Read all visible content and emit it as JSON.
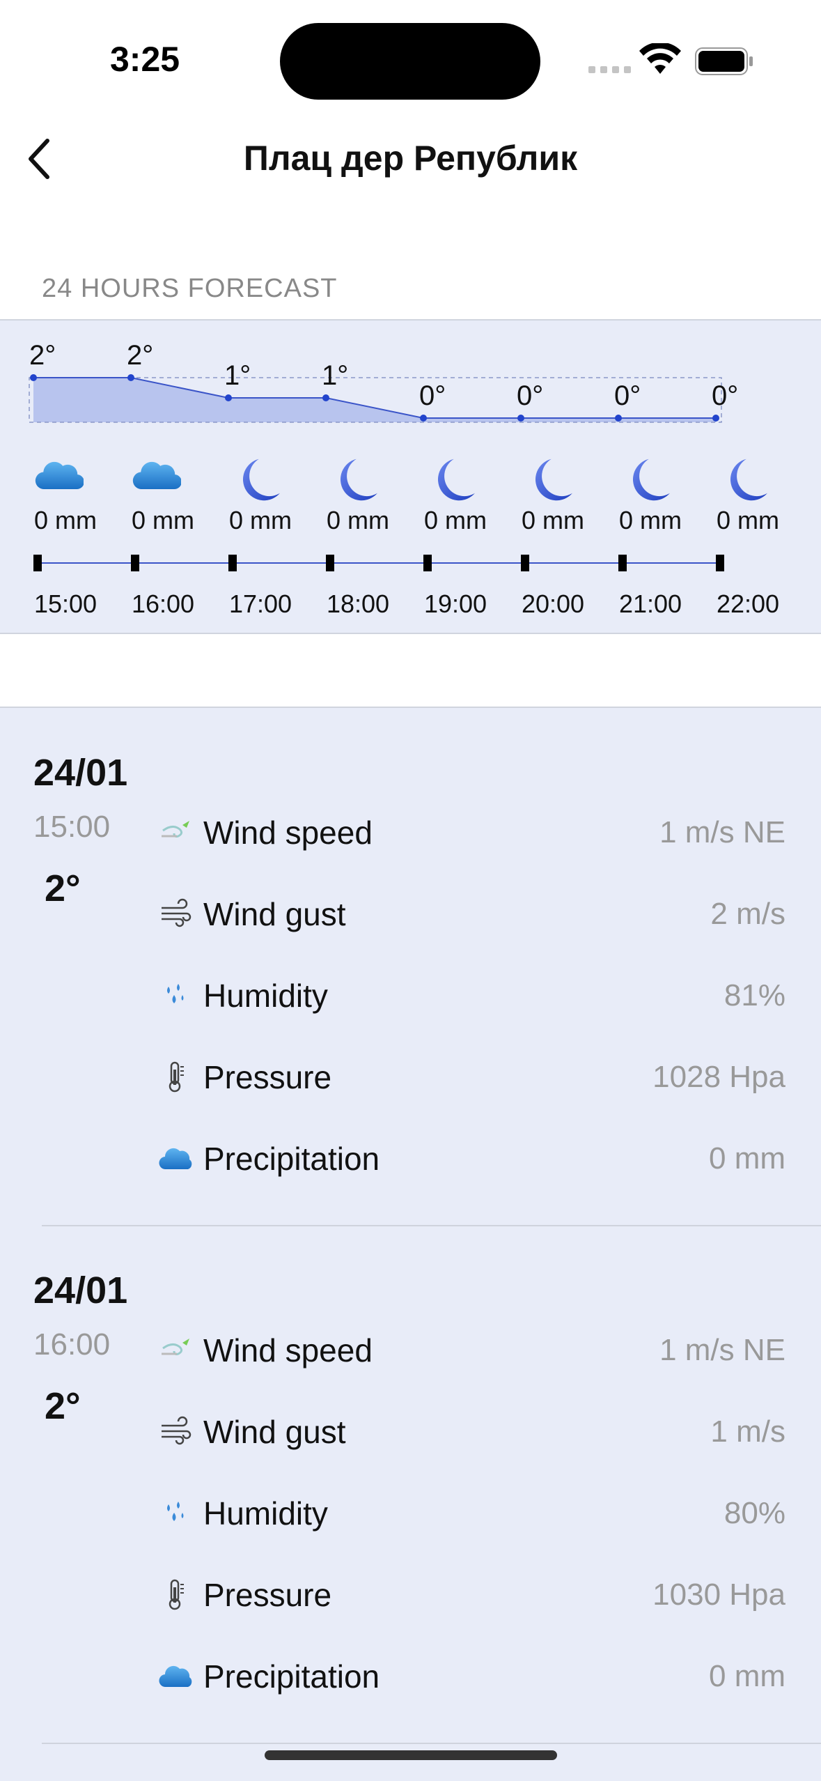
{
  "status": {
    "time": "3:25"
  },
  "nav": {
    "title": "Плац дер Републик",
    "back_icon": "chevron-left-icon"
  },
  "section_label": "24 HOURS FORECAST",
  "forecast": {
    "hours": [
      {
        "time": "15:00",
        "temp": "2°",
        "temp_value": 2,
        "precip": "0 mm",
        "icon": "cloud-icon"
      },
      {
        "time": "16:00",
        "temp": "2°",
        "temp_value": 2,
        "precip": "0 mm",
        "icon": "cloud-icon"
      },
      {
        "time": "17:00",
        "temp": "1°",
        "temp_value": 1,
        "precip": "0 mm",
        "icon": "moon-icon"
      },
      {
        "time": "18:00",
        "temp": "1°",
        "temp_value": 1,
        "precip": "0 mm",
        "icon": "moon-icon"
      },
      {
        "time": "19:00",
        "temp": "0°",
        "temp_value": 0,
        "precip": "0 mm",
        "icon": "moon-icon"
      },
      {
        "time": "20:00",
        "temp": "0°",
        "temp_value": 0,
        "precip": "0 mm",
        "icon": "moon-icon"
      },
      {
        "time": "21:00",
        "temp": "0°",
        "temp_value": 0,
        "precip": "0 mm",
        "icon": "moon-icon"
      },
      {
        "time": "22:00",
        "temp": "0°",
        "temp_value": 0,
        "precip": "0 mm",
        "icon": "moon-icon"
      }
    ]
  },
  "details": [
    {
      "date": "24/01",
      "time": "15:00",
      "temp": "2°",
      "rows": [
        {
          "icon": "wind-speed-icon",
          "label": "Wind speed",
          "value": "1 m/s NE"
        },
        {
          "icon": "wind-gust-icon",
          "label": "Wind gust",
          "value": "2 m/s"
        },
        {
          "icon": "humidity-icon",
          "label": "Humidity",
          "value": "81%"
        },
        {
          "icon": "thermometer-icon",
          "label": "Pressure",
          "value": "1028 Hpa"
        },
        {
          "icon": "cloud-icon",
          "label": "Precipitation",
          "value": "0 mm"
        }
      ]
    },
    {
      "date": "24/01",
      "time": "16:00",
      "temp": "2°",
      "rows": [
        {
          "icon": "wind-speed-icon",
          "label": "Wind speed",
          "value": "1 m/s NE"
        },
        {
          "icon": "wind-gust-icon",
          "label": "Wind gust",
          "value": "1 m/s"
        },
        {
          "icon": "humidity-icon",
          "label": "Humidity",
          "value": "80%"
        },
        {
          "icon": "thermometer-icon",
          "label": "Pressure",
          "value": "1030 Hpa"
        },
        {
          "icon": "cloud-icon",
          "label": "Precipitation",
          "value": "0 mm"
        }
      ]
    }
  ],
  "colors": {
    "accent": "#2244cc",
    "strip_bg": "#e8ecf8",
    "muted_text": "#999999"
  }
}
